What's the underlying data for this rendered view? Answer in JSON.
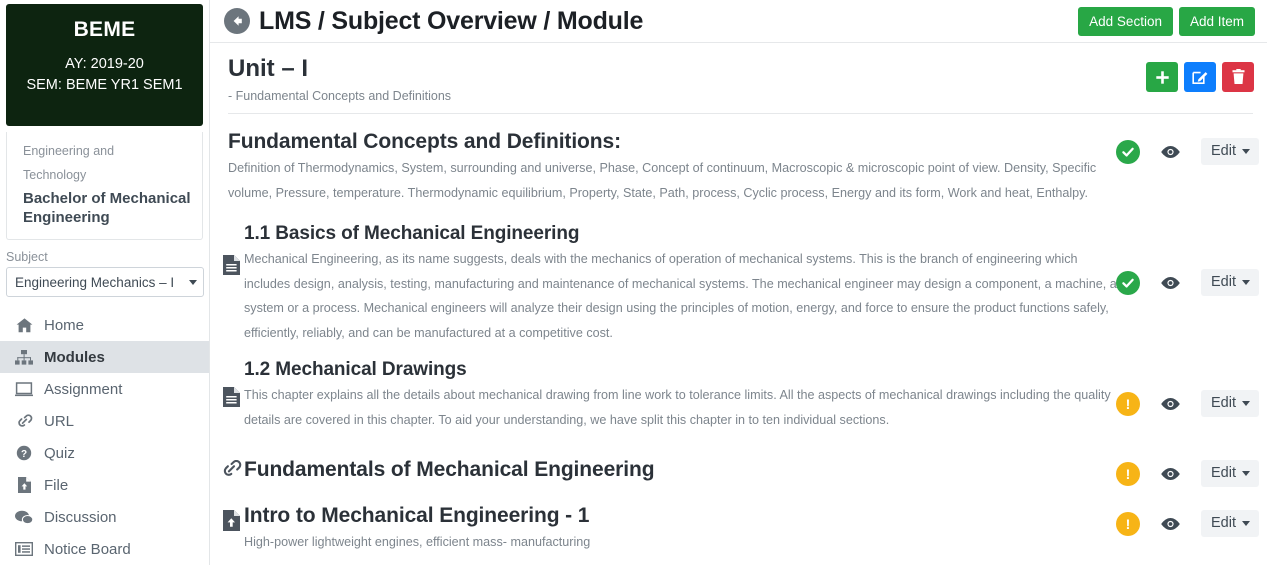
{
  "sidebar": {
    "brand": {
      "code": "BEME",
      "academic_year": "AY: 2019-20",
      "semester": "SEM: BEME YR1 SEM1"
    },
    "course": {
      "faculty_line1": "Engineering and",
      "faculty_line2": "Technology",
      "degree": "Bachelor of Mechanical Engineering"
    },
    "subject": {
      "label": "Subject",
      "selected": "Engineering Mechanics – I"
    },
    "items": [
      {
        "label": "Home",
        "icon": "home-icon",
        "active": false
      },
      {
        "label": "Modules",
        "icon": "modules-icon",
        "active": true
      },
      {
        "label": "Assignment",
        "icon": "assignment-icon",
        "active": false
      },
      {
        "label": "URL",
        "icon": "link-icon",
        "active": false
      },
      {
        "label": "Quiz",
        "icon": "question-circle-icon",
        "active": false
      },
      {
        "label": "File",
        "icon": "file-upload-icon",
        "active": false
      },
      {
        "label": "Discussion",
        "icon": "chat-icon",
        "active": false
      },
      {
        "label": "Notice Board",
        "icon": "notice-board-icon",
        "active": false
      }
    ]
  },
  "header": {
    "back_icon": "back-arrow-icon",
    "title": "LMS / Subject Overview / Module",
    "add_section_label": "Add Section",
    "add_item_label": "Add Item"
  },
  "unit": {
    "title": "Unit – I",
    "subtitle": "- Fundamental Concepts and Definitions",
    "actions": [
      {
        "name": "add-button",
        "icon": "plus-icon",
        "color": "#28a745"
      },
      {
        "name": "edit-button",
        "icon": "pencil-square-icon",
        "color": "#0d7efd"
      },
      {
        "name": "delete-button",
        "icon": "trash-icon",
        "color": "#dc3545"
      }
    ]
  },
  "controls": {
    "edit_label": "Edit",
    "eye_icon": "eye-icon",
    "status_ok_icon": "check-circle-icon",
    "status_warn_icon": "exclamation-circle-icon"
  },
  "colors": {
    "brand_dark": "#0d2410",
    "success": "#28a745",
    "status_ok": "#2aa84a",
    "status_warn": "#f7b416",
    "primary": "#0d7efd",
    "danger": "#dc3545",
    "muted_text": "#7d858d",
    "heading": "#2b3138"
  },
  "blocks": [
    {
      "id": "fundamental-concepts",
      "heading": "Fundamental Concepts and Definitions:",
      "body": "Definition of Thermodynamics, System, surrounding and universe, Phase, Concept of continuum, Macroscopic & microscopic point of view. Density, Specific volume, Pressure, temperature. Thermodynamic equilibrium, Property, State, Path, process, Cyclic process, Energy and its form, Work and heat, Enthalpy.",
      "icon": null,
      "status": "ok",
      "indent": false
    },
    {
      "id": "basics-of-mechanical-engineering",
      "heading": "1.1 Basics of Mechanical Engineering",
      "body": "Mechanical Engineering, as its name suggests, deals with the mechanics of operation of mechanical systems. This is the branch of engineering which includes design, analysis, testing, manufacturing and maintenance of mechanical systems. The mechanical engineer may design a component, a machine, a system or a process. Mechanical engineers will analyze their design using the principles of motion, energy, and force to ensure the product functions safely, efficiently, reliably, and can be manufactured at a competitive cost.",
      "icon": "document-icon",
      "status": "ok",
      "indent": true
    },
    {
      "id": "mechanical-drawings",
      "heading": "1.2 Mechanical Drawings",
      "body": "This chapter explains all the details about mechanical drawing from line work to tolerance limits. All the aspects of mechanical drawings including the quality details are covered in this chapter. To aid your understanding, we have split this chapter in to ten individual sections.",
      "icon": "document-icon",
      "status": "warn",
      "indent": true
    },
    {
      "id": "fundamentals-of-mechanical-engineering",
      "heading": "Fundamentals of Mechanical Engineering",
      "body": "",
      "icon": "link-icon",
      "status": "warn",
      "indent": true
    },
    {
      "id": "intro-to-mechanical-engineering-1",
      "heading": "Intro to Mechanical Engineering - 1",
      "body": "High-power lightweight engines, efficient mass- manufacturing",
      "icon": "file-upload-icon",
      "status": "warn",
      "indent": true
    }
  ]
}
